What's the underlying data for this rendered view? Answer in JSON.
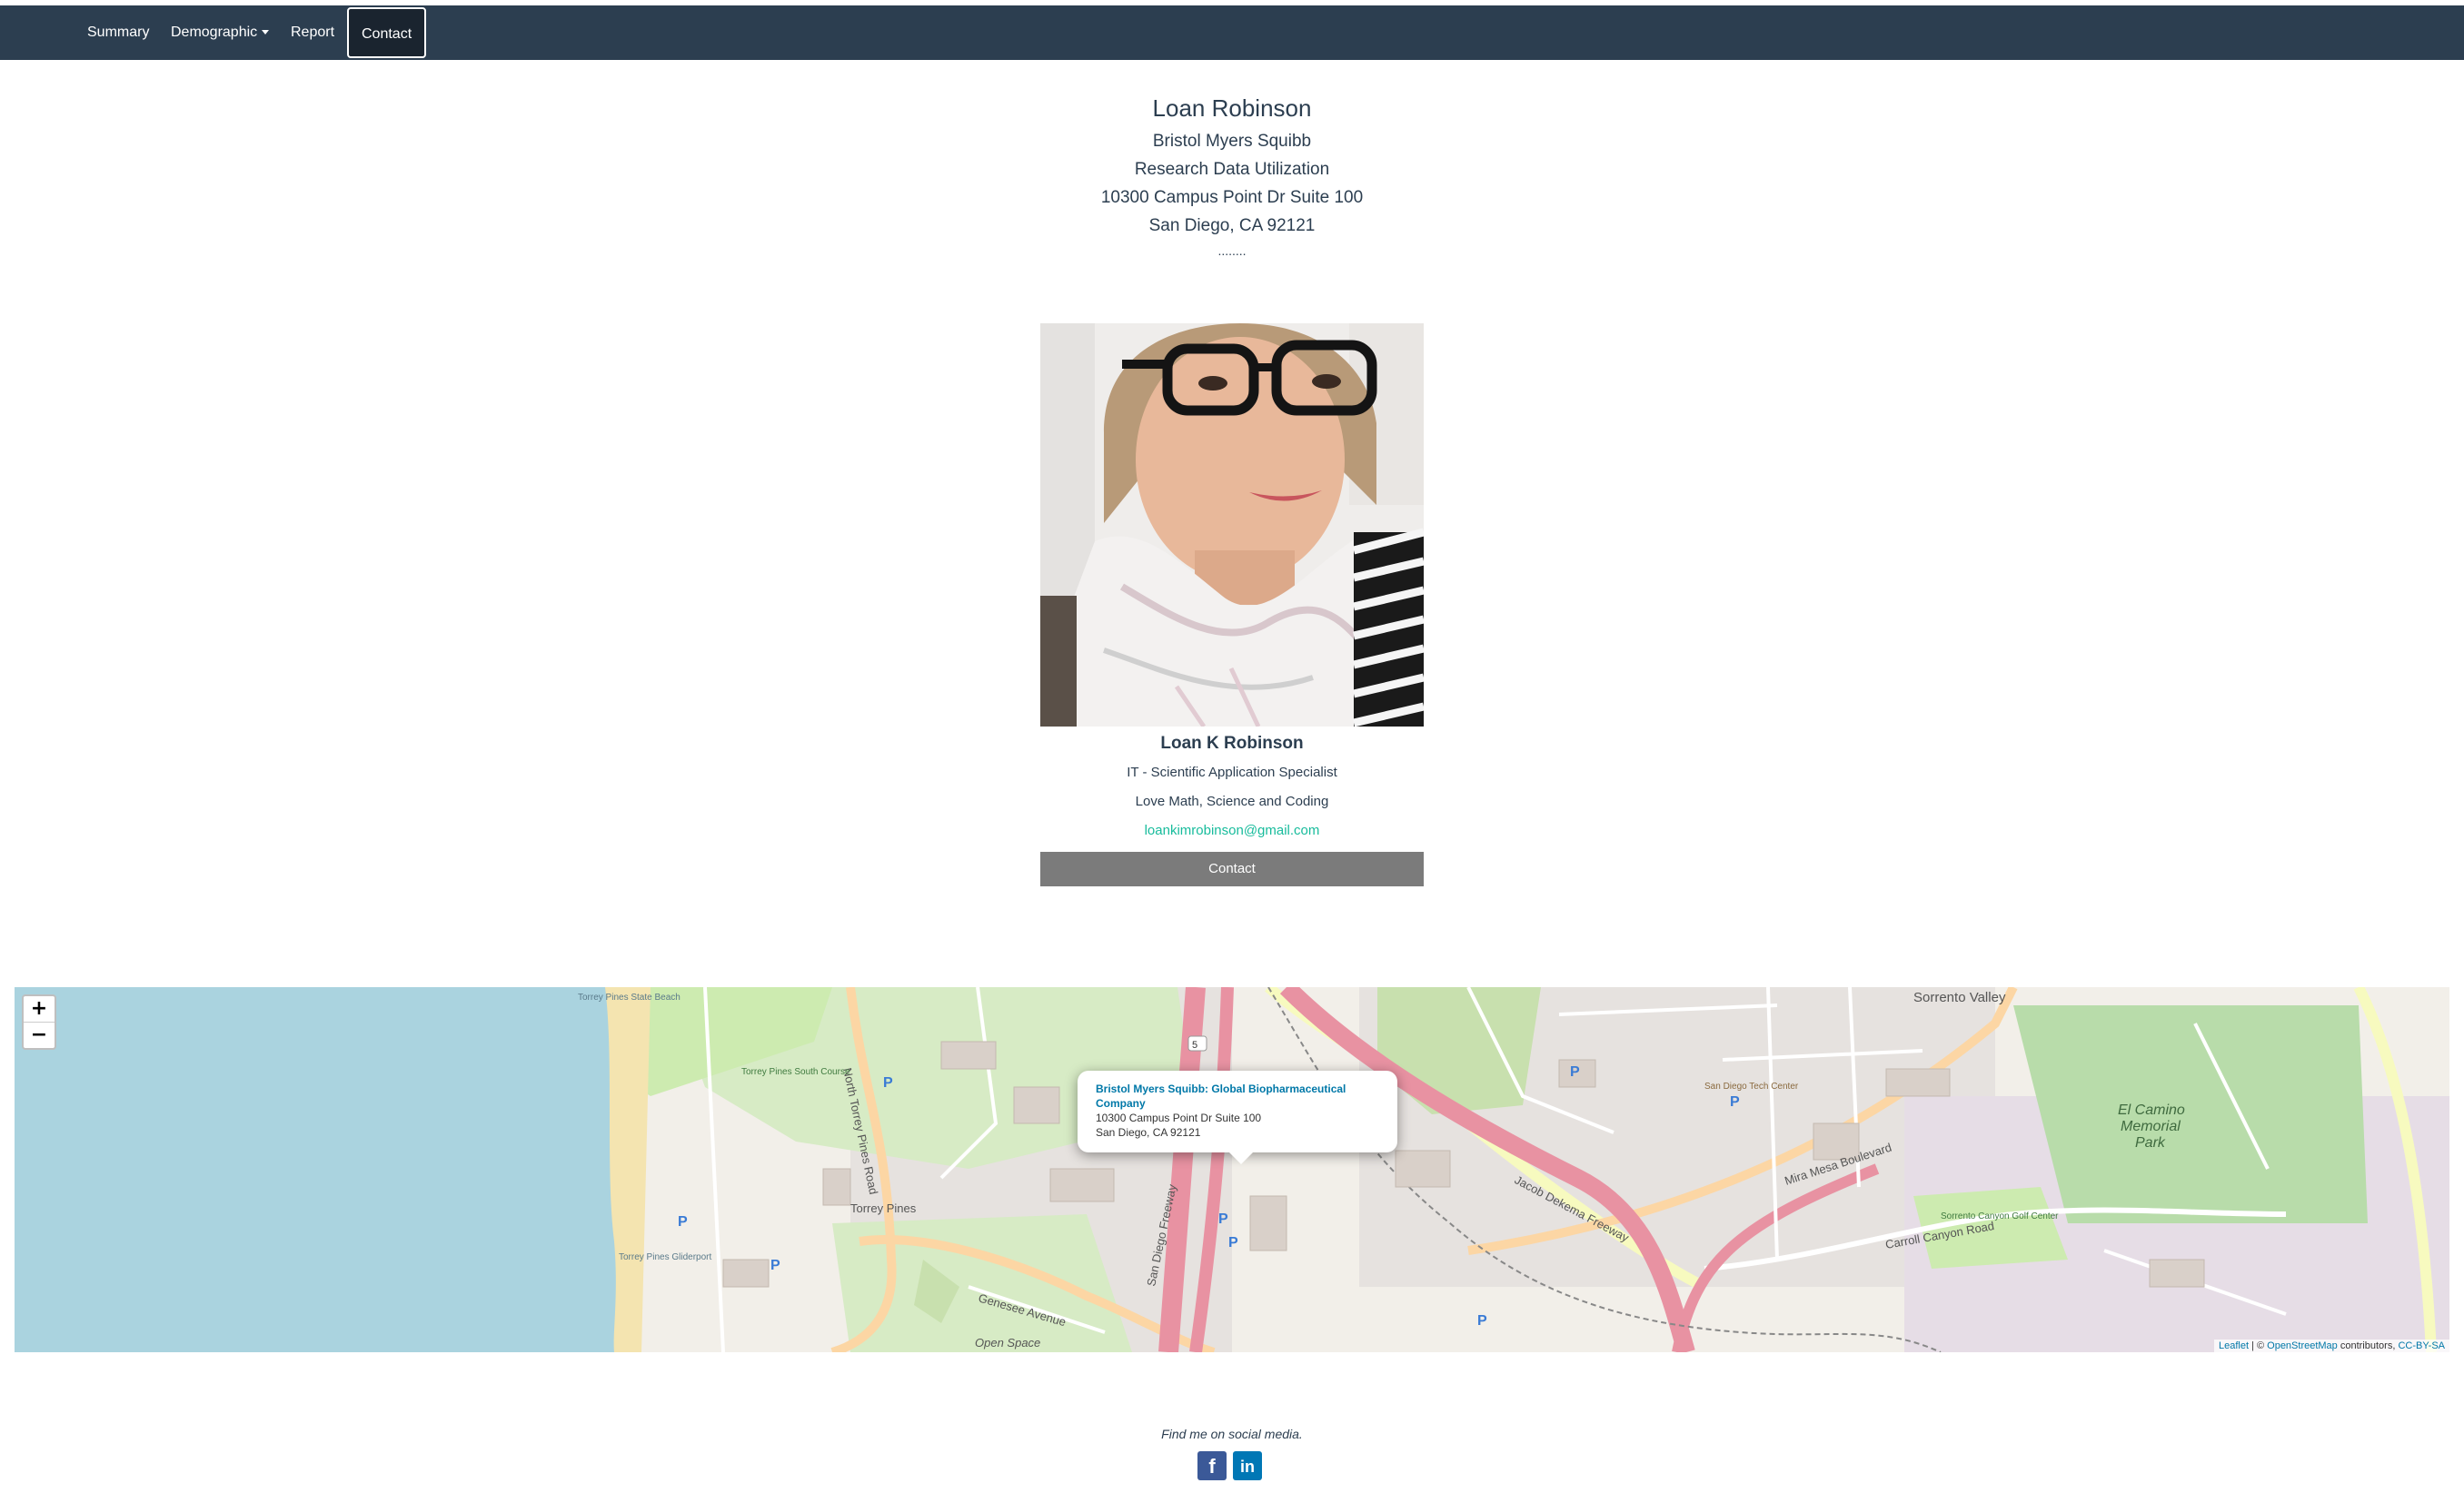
{
  "nav": {
    "summary": "Summary",
    "demographic": "Demographic",
    "report": "Report",
    "contact": "Contact"
  },
  "header": {
    "name": "Loan Robinson",
    "company": "Bristol Myers Squibb",
    "department": "Research Data Utilization",
    "address": "10300 Campus Point Dr Suite 100",
    "city": "San Diego, CA 92121",
    "dots": "........"
  },
  "card": {
    "full_name": "Loan K Robinson",
    "title": "IT - Scientific Application Specialist",
    "tagline": "Love Math, Science and Coding",
    "email": "loankimrobinson@gmail.com",
    "button": "Contact"
  },
  "map": {
    "zoom_in": "+",
    "zoom_out": "−",
    "popup": {
      "title": "Bristol Myers Squibb: Global Biopharmaceutical Company",
      "address": "10300 Campus Point Dr Suite 100",
      "city": "San Diego, CA 92121"
    },
    "attribution": {
      "leaflet": "Leaflet",
      "sep": " | © ",
      "osm": "OpenStreetMap",
      "contrib": " contributors, ",
      "license": "CC-BY-SA"
    },
    "labels": {
      "torrey_pines": "Torrey Pines",
      "el_camino": "El Camino",
      "memorial": "Memorial",
      "park": "Park",
      "sorrento_valley": "Sorrento Valley",
      "genesee": "Genesee Avenue",
      "san_diego_fwy": "San Diego Freeway",
      "jacob_dekema": "Jacob Dekema Freeway",
      "mira_mesa": "Mira Mesa Boulevard",
      "carroll_canyon": "Carroll Canyon Road",
      "north_torrey": "North Torrey Pines Road",
      "open_space": "Open Space",
      "sorrento_golf": "Sorrento Canyon Golf Center",
      "torrey_course": "Torrey Pines South Course",
      "torrey_beach": "Torrey Pines State Beach",
      "gliderport": "Torrey Pines Gliderport",
      "sd_tech": "San Diego Tech Center",
      "route": "5"
    },
    "colors": {
      "water": "#aad3df",
      "freeway": "#e892a2",
      "primary": "#fcd6a4",
      "park": "#c8facc",
      "residential": "#e0dfdf"
    }
  },
  "footer": {
    "text": "Find me on social media.",
    "facebook_icon": "f",
    "linkedin_icon": "in"
  }
}
